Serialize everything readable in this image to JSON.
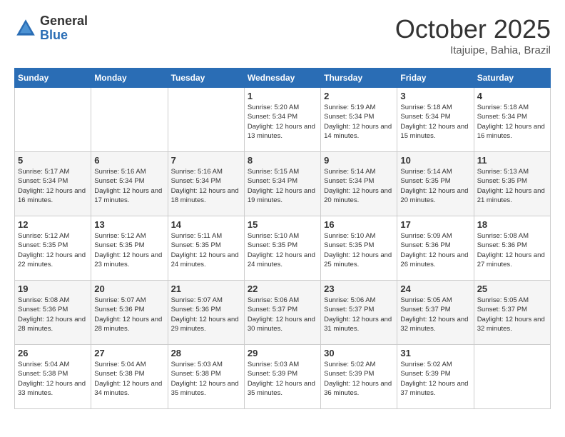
{
  "header": {
    "logo_general": "General",
    "logo_blue": "Blue",
    "title": "October 2025",
    "subtitle": "Itajuipe, Bahia, Brazil"
  },
  "days_of_week": [
    "Sunday",
    "Monday",
    "Tuesday",
    "Wednesday",
    "Thursday",
    "Friday",
    "Saturday"
  ],
  "weeks": [
    [
      {
        "day": "",
        "sunrise": "",
        "sunset": "",
        "daylight": ""
      },
      {
        "day": "",
        "sunrise": "",
        "sunset": "",
        "daylight": ""
      },
      {
        "day": "",
        "sunrise": "",
        "sunset": "",
        "daylight": ""
      },
      {
        "day": "1",
        "sunrise": "Sunrise: 5:20 AM",
        "sunset": "Sunset: 5:34 PM",
        "daylight": "Daylight: 12 hours and 13 minutes."
      },
      {
        "day": "2",
        "sunrise": "Sunrise: 5:19 AM",
        "sunset": "Sunset: 5:34 PM",
        "daylight": "Daylight: 12 hours and 14 minutes."
      },
      {
        "day": "3",
        "sunrise": "Sunrise: 5:18 AM",
        "sunset": "Sunset: 5:34 PM",
        "daylight": "Daylight: 12 hours and 15 minutes."
      },
      {
        "day": "4",
        "sunrise": "Sunrise: 5:18 AM",
        "sunset": "Sunset: 5:34 PM",
        "daylight": "Daylight: 12 hours and 16 minutes."
      }
    ],
    [
      {
        "day": "5",
        "sunrise": "Sunrise: 5:17 AM",
        "sunset": "Sunset: 5:34 PM",
        "daylight": "Daylight: 12 hours and 16 minutes."
      },
      {
        "day": "6",
        "sunrise": "Sunrise: 5:16 AM",
        "sunset": "Sunset: 5:34 PM",
        "daylight": "Daylight: 12 hours and 17 minutes."
      },
      {
        "day": "7",
        "sunrise": "Sunrise: 5:16 AM",
        "sunset": "Sunset: 5:34 PM",
        "daylight": "Daylight: 12 hours and 18 minutes."
      },
      {
        "day": "8",
        "sunrise": "Sunrise: 5:15 AM",
        "sunset": "Sunset: 5:34 PM",
        "daylight": "Daylight: 12 hours and 19 minutes."
      },
      {
        "day": "9",
        "sunrise": "Sunrise: 5:14 AM",
        "sunset": "Sunset: 5:34 PM",
        "daylight": "Daylight: 12 hours and 20 minutes."
      },
      {
        "day": "10",
        "sunrise": "Sunrise: 5:14 AM",
        "sunset": "Sunset: 5:35 PM",
        "daylight": "Daylight: 12 hours and 20 minutes."
      },
      {
        "day": "11",
        "sunrise": "Sunrise: 5:13 AM",
        "sunset": "Sunset: 5:35 PM",
        "daylight": "Daylight: 12 hours and 21 minutes."
      }
    ],
    [
      {
        "day": "12",
        "sunrise": "Sunrise: 5:12 AM",
        "sunset": "Sunset: 5:35 PM",
        "daylight": "Daylight: 12 hours and 22 minutes."
      },
      {
        "day": "13",
        "sunrise": "Sunrise: 5:12 AM",
        "sunset": "Sunset: 5:35 PM",
        "daylight": "Daylight: 12 hours and 23 minutes."
      },
      {
        "day": "14",
        "sunrise": "Sunrise: 5:11 AM",
        "sunset": "Sunset: 5:35 PM",
        "daylight": "Daylight: 12 hours and 24 minutes."
      },
      {
        "day": "15",
        "sunrise": "Sunrise: 5:10 AM",
        "sunset": "Sunset: 5:35 PM",
        "daylight": "Daylight: 12 hours and 24 minutes."
      },
      {
        "day": "16",
        "sunrise": "Sunrise: 5:10 AM",
        "sunset": "Sunset: 5:35 PM",
        "daylight": "Daylight: 12 hours and 25 minutes."
      },
      {
        "day": "17",
        "sunrise": "Sunrise: 5:09 AM",
        "sunset": "Sunset: 5:36 PM",
        "daylight": "Daylight: 12 hours and 26 minutes."
      },
      {
        "day": "18",
        "sunrise": "Sunrise: 5:08 AM",
        "sunset": "Sunset: 5:36 PM",
        "daylight": "Daylight: 12 hours and 27 minutes."
      }
    ],
    [
      {
        "day": "19",
        "sunrise": "Sunrise: 5:08 AM",
        "sunset": "Sunset: 5:36 PM",
        "daylight": "Daylight: 12 hours and 28 minutes."
      },
      {
        "day": "20",
        "sunrise": "Sunrise: 5:07 AM",
        "sunset": "Sunset: 5:36 PM",
        "daylight": "Daylight: 12 hours and 28 minutes."
      },
      {
        "day": "21",
        "sunrise": "Sunrise: 5:07 AM",
        "sunset": "Sunset: 5:36 PM",
        "daylight": "Daylight: 12 hours and 29 minutes."
      },
      {
        "day": "22",
        "sunrise": "Sunrise: 5:06 AM",
        "sunset": "Sunset: 5:37 PM",
        "daylight": "Daylight: 12 hours and 30 minutes."
      },
      {
        "day": "23",
        "sunrise": "Sunrise: 5:06 AM",
        "sunset": "Sunset: 5:37 PM",
        "daylight": "Daylight: 12 hours and 31 minutes."
      },
      {
        "day": "24",
        "sunrise": "Sunrise: 5:05 AM",
        "sunset": "Sunset: 5:37 PM",
        "daylight": "Daylight: 12 hours and 32 minutes."
      },
      {
        "day": "25",
        "sunrise": "Sunrise: 5:05 AM",
        "sunset": "Sunset: 5:37 PM",
        "daylight": "Daylight: 12 hours and 32 minutes."
      }
    ],
    [
      {
        "day": "26",
        "sunrise": "Sunrise: 5:04 AM",
        "sunset": "Sunset: 5:38 PM",
        "daylight": "Daylight: 12 hours and 33 minutes."
      },
      {
        "day": "27",
        "sunrise": "Sunrise: 5:04 AM",
        "sunset": "Sunset: 5:38 PM",
        "daylight": "Daylight: 12 hours and 34 minutes."
      },
      {
        "day": "28",
        "sunrise": "Sunrise: 5:03 AM",
        "sunset": "Sunset: 5:38 PM",
        "daylight": "Daylight: 12 hours and 35 minutes."
      },
      {
        "day": "29",
        "sunrise": "Sunrise: 5:03 AM",
        "sunset": "Sunset: 5:39 PM",
        "daylight": "Daylight: 12 hours and 35 minutes."
      },
      {
        "day": "30",
        "sunrise": "Sunrise: 5:02 AM",
        "sunset": "Sunset: 5:39 PM",
        "daylight": "Daylight: 12 hours and 36 minutes."
      },
      {
        "day": "31",
        "sunrise": "Sunrise: 5:02 AM",
        "sunset": "Sunset: 5:39 PM",
        "daylight": "Daylight: 12 hours and 37 minutes."
      },
      {
        "day": "",
        "sunrise": "",
        "sunset": "",
        "daylight": ""
      }
    ]
  ]
}
